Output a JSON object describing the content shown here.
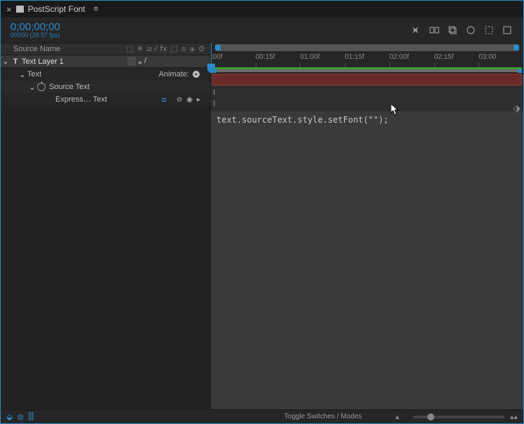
{
  "tab": {
    "title": "PostScript Font"
  },
  "timecode": {
    "main": "0;00;00;00",
    "sub": "00000 (29.97 fps)"
  },
  "columns": {
    "sourceName": "Source Name",
    "switches": "⬚ ✳ ⧄ ⁄ fx ⬚ ⦾ ⦿ ⊙"
  },
  "layer": {
    "name": "Text Layer 1"
  },
  "props": {
    "text": "Text",
    "animate": "Animate:",
    "sourceText": "Source Text",
    "expression": "Express… Text"
  },
  "ruler": {
    "ticks": [
      ":00f",
      "00:15f",
      "01:00f",
      "01:15f",
      "02:00f",
      "02:15f",
      "03:00"
    ]
  },
  "expression": {
    "code": "text.sourceText.style.setFont(\"\");"
  },
  "footer": {
    "toggle": "Toggle Switches / Modes"
  }
}
